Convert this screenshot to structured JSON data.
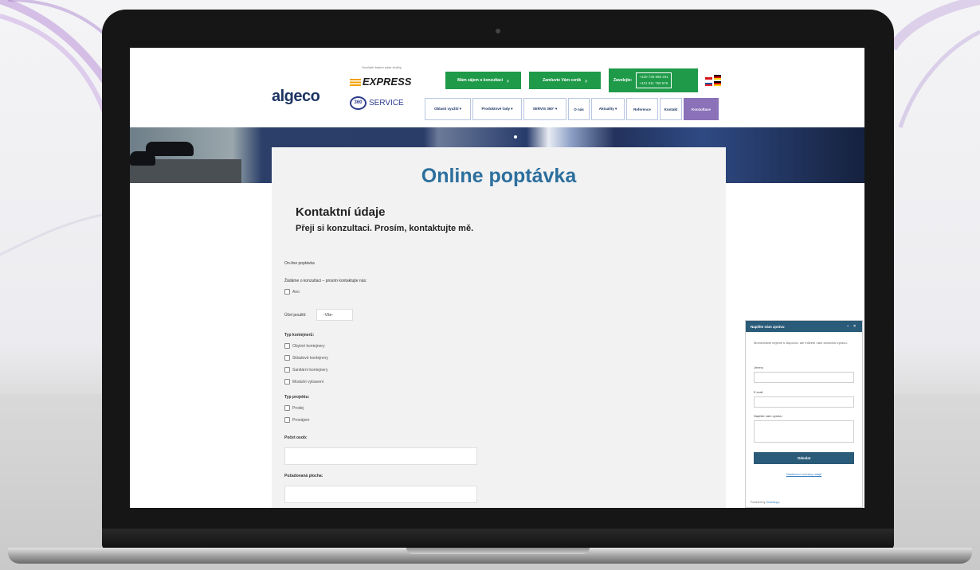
{
  "header": {
    "logo": "algeco",
    "partner_caption": "Součástí balení naše služby",
    "express": "EXPRESS",
    "service": "SERVICE",
    "service_badge": "360",
    "cta_consult": "Mám zájem o konzultaci",
    "cta_offer": "Zamluvte Vám ceník",
    "phone_label": "Zavolejte:",
    "phone_1": "+420 735 695 201",
    "phone_2": "+421 911 758 576"
  },
  "menu": [
    {
      "label": "Oblasti využití ▾"
    },
    {
      "label": "Produktové řady ▾"
    },
    {
      "label": "SERVIS 360° ▾"
    },
    {
      "label": "O nás"
    },
    {
      "label": "Aktuality ▾"
    },
    {
      "label": "Reference"
    },
    {
      "label": "Kontakt"
    },
    {
      "label": "Konzultace"
    }
  ],
  "form": {
    "title": "Online poptávka",
    "section": "Kontaktní údaje",
    "subtitle": "Přeji si konzultaci. Prosím, kontaktujte mě.",
    "online_label": "On-line poptávka",
    "consult_label": "Žádáme o konzultaci – prosím kontaktujte nás:",
    "consult_option": "Ano",
    "use_label": "Účel použití:",
    "use_select": "-Vše-",
    "type_label": "Typ kontejnerů:",
    "type_options": [
      "Obytné kontejnery",
      "Skladové kontejnery",
      "Sanitární kontejnery",
      "Modulní vybavení"
    ],
    "project_label": "Typ projektu:",
    "project_options": [
      "Prodej",
      "Pronájem"
    ],
    "persons_label": "Počet osob:",
    "area_label": "Požadovaná plocha:"
  },
  "chat": {
    "title": "Napište nám zprávu",
    "controls": "– ×",
    "intro": "Momentálně nejsme k dispozici, ale můžete nám zanechat zprávu.",
    "name_label": "Jméno",
    "email_label": "E-mail",
    "message_label": "Napište nám zprávu",
    "send": "Odeslat",
    "link": "Nastavení ochrany údajů",
    "powered_prefix": "Powered by",
    "powered_brand": "Smartsupp"
  },
  "colors": {
    "green": "#1f9a49",
    "navy": "#1d3564",
    "purple": "#8a71b8",
    "title_blue": "#2c6f9d",
    "chat_blue": "#2a5b79"
  }
}
